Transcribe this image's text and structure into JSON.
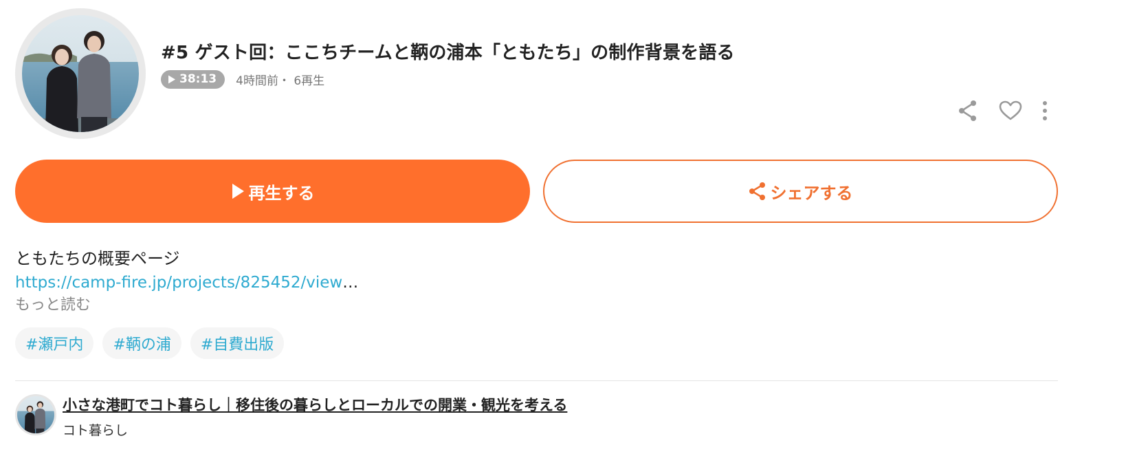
{
  "episode": {
    "title": "#5 ゲスト回：ここちチームと鞆の浦本「ともたち」の制作背景を語る",
    "duration": "38:13",
    "meta": "4時間前・ 6再生"
  },
  "actions": {
    "icons": [
      "share-icon",
      "heart-icon",
      "more-vertical-icon"
    ]
  },
  "buttons": {
    "play_label": "再生する",
    "share_label": "シェアする"
  },
  "description": {
    "line1": "ともたちの概要ページ",
    "link": "https://camp-fire.jp/projects/825452/view",
    "ellipsis": "…",
    "read_more": "もっと読む"
  },
  "tags": [
    "#瀬戸内",
    "#鞆の浦",
    "#自費出版"
  ],
  "show": {
    "title": "小さな港町でコト暮らし｜移住後の暮らしとローカルでの開業・観光を考える",
    "author": "コト暮らし"
  },
  "colors": {
    "accent": "#ff6f2c",
    "link": "#2eaad0",
    "badge": "#a8a8a8"
  }
}
